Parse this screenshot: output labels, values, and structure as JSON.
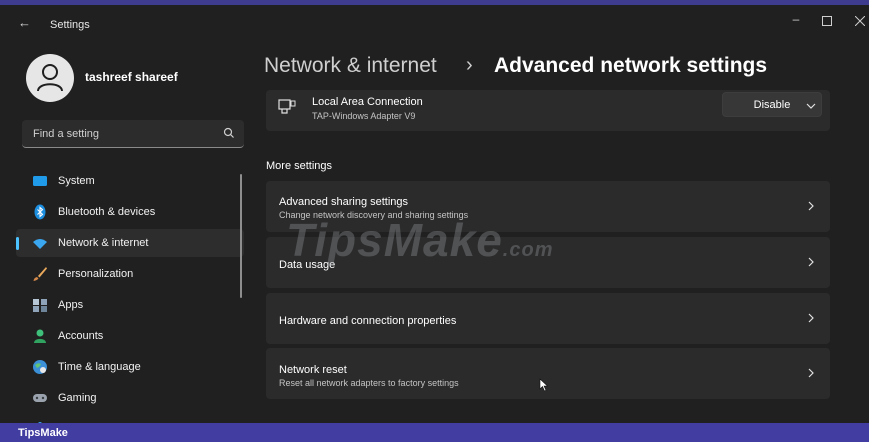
{
  "window": {
    "title": "Settings"
  },
  "user": {
    "name": "tashreef shareef"
  },
  "search": {
    "placeholder": "Find a setting"
  },
  "nav": [
    {
      "label": "System"
    },
    {
      "label": "Bluetooth & devices"
    },
    {
      "label": "Network & internet"
    },
    {
      "label": "Personalization"
    },
    {
      "label": "Apps"
    },
    {
      "label": "Accounts"
    },
    {
      "label": "Time & language"
    },
    {
      "label": "Gaming"
    }
  ],
  "breadcrumb": {
    "parent": "Network & internet",
    "separator": "›",
    "current": "Advanced network settings"
  },
  "adapter": {
    "name": "Local Area Connection",
    "description": "TAP-Windows Adapter V9",
    "action": "Disable"
  },
  "more_settings": {
    "heading": "More settings",
    "items": [
      {
        "title": "Advanced sharing settings",
        "subtitle": "Change network discovery and sharing settings"
      },
      {
        "title": "Data usage",
        "subtitle": ""
      },
      {
        "title": "Hardware and connection properties",
        "subtitle": ""
      },
      {
        "title": "Network reset",
        "subtitle": "Reset all network adapters to factory settings"
      }
    ]
  },
  "watermark": {
    "main": "TipsMake",
    "suffix": ".com"
  },
  "footer": {
    "brand": "TipsMake"
  },
  "colors": {
    "accent": "#4cc2ff",
    "window_bg": "#202020",
    "card_bg": "#2b2b2b",
    "footer_bg": "#423da1"
  }
}
